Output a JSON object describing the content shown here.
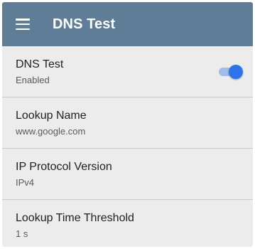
{
  "app_bar": {
    "menu_icon": "hamburger-menu-icon",
    "title": "DNS Test",
    "background_color": "#5f7d96"
  },
  "settings": [
    {
      "title": "DNS Test",
      "subtitle": "Enabled",
      "toggle": {
        "on": true,
        "accent_color": "#2e74e8"
      }
    },
    {
      "title": "Lookup Name",
      "subtitle": "www.google.com"
    },
    {
      "title": "IP Protocol Version",
      "subtitle": "IPv4"
    },
    {
      "title": "Lookup Time Threshold",
      "subtitle": "1 s"
    }
  ]
}
